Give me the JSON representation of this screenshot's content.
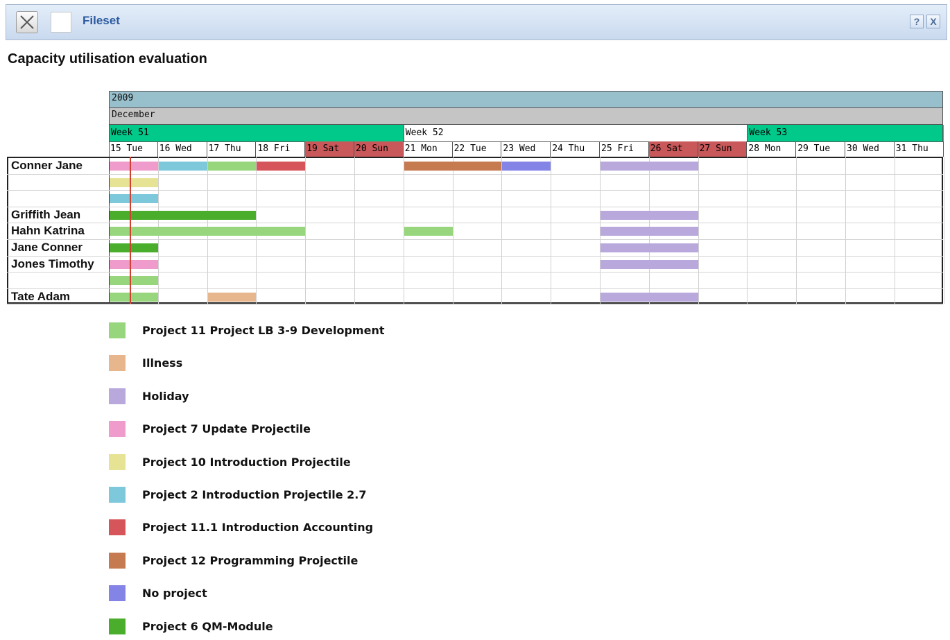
{
  "window": {
    "title": "Fileset",
    "help_label": "?",
    "close_label": "X"
  },
  "page_title": "Capacity utilisation evaluation",
  "timeline": {
    "year": "2009",
    "month": "December",
    "weeks": [
      {
        "label": "Week 51",
        "color": "#00c98a"
      },
      {
        "label": "Week 52",
        "color": "#ffffff"
      },
      {
        "label": "Week 53",
        "color": "#00c98a"
      }
    ],
    "days": [
      {
        "label": "15 Tue",
        "weekend": false
      },
      {
        "label": "16 Wed",
        "weekend": false
      },
      {
        "label": "17 Thu",
        "weekend": false
      },
      {
        "label": "18 Fri",
        "weekend": false
      },
      {
        "label": "19 Sat",
        "weekend": true
      },
      {
        "label": "20 Sun",
        "weekend": true
      },
      {
        "label": "21 Mon",
        "weekend": false
      },
      {
        "label": "22 Tue",
        "weekend": false
      },
      {
        "label": "23 Wed",
        "weekend": false
      },
      {
        "label": "24 Thu",
        "weekend": false
      },
      {
        "label": "25 Fri",
        "weekend": false
      },
      {
        "label": "26 Sat",
        "weekend": true
      },
      {
        "label": "27 Sun",
        "weekend": true
      },
      {
        "label": "28 Mon",
        "weekend": false
      },
      {
        "label": "29 Tue",
        "weekend": false
      },
      {
        "label": "30 Wed",
        "weekend": false
      },
      {
        "label": "31 Thu",
        "weekend": false
      }
    ],
    "today": "15 Tue"
  },
  "colors": {
    "year_bar": "#98c0cc",
    "month_bar": "#c5c5c5",
    "weekend": "#c8585a",
    "today_line": "#d04030"
  },
  "rows": [
    {
      "name": "Conner Jane",
      "bookings": [
        {
          "project": "p7",
          "from": "15 Tue",
          "to": "15 Tue"
        },
        {
          "project": "p2",
          "from": "16 Wed",
          "to": "16 Wed"
        },
        {
          "project": "p11",
          "from": "17 Thu",
          "to": "17 Thu"
        },
        {
          "project": "p111",
          "from": "18 Fri",
          "to": "18 Fri"
        },
        {
          "project": "p12",
          "from": "21 Mon",
          "to": "22 Tue"
        },
        {
          "project": "none",
          "from": "23 Wed",
          "to": "23 Wed"
        },
        {
          "project": "holiday",
          "from": "25 Fri",
          "to": "26 Sat"
        }
      ]
    },
    {
      "name": "",
      "bookings": [
        {
          "project": "p10",
          "from": "15 Tue",
          "to": "15 Tue"
        }
      ]
    },
    {
      "name": "",
      "bookings": [
        {
          "project": "p2",
          "from": "15 Tue",
          "to": "15 Tue"
        }
      ]
    },
    {
      "name": "Griffith Jean",
      "bookings": [
        {
          "project": "p6",
          "from": "15 Tue",
          "to": "17 Thu"
        },
        {
          "project": "holiday",
          "from": "25 Fri",
          "to": "26 Sat"
        }
      ]
    },
    {
      "name": "Hahn Katrina",
      "bookings": [
        {
          "project": "p11",
          "from": "15 Tue",
          "to": "18 Fri"
        },
        {
          "project": "p11",
          "from": "21 Mon",
          "to": "21 Mon"
        },
        {
          "project": "holiday",
          "from": "25 Fri",
          "to": "26 Sat"
        }
      ]
    },
    {
      "name": "Jane Conner",
      "bookings": [
        {
          "project": "p6",
          "from": "15 Tue",
          "to": "15 Tue"
        },
        {
          "project": "holiday",
          "from": "25 Fri",
          "to": "26 Sat"
        }
      ]
    },
    {
      "name": "Jones Timothy",
      "bookings": [
        {
          "project": "p7",
          "from": "15 Tue",
          "to": "15 Tue"
        },
        {
          "project": "holiday",
          "from": "25 Fri",
          "to": "26 Sat"
        }
      ]
    },
    {
      "name": "",
      "bookings": [
        {
          "project": "p11",
          "from": "15 Tue",
          "to": "15 Tue"
        }
      ]
    },
    {
      "name": "Tate Adam",
      "bookings": [
        {
          "project": "p11",
          "from": "15 Tue",
          "to": "15 Tue"
        },
        {
          "project": "illness",
          "from": "17 Thu",
          "to": "17 Thu"
        },
        {
          "project": "holiday",
          "from": "25 Fri",
          "to": "26 Sat"
        }
      ]
    }
  ],
  "legend": [
    {
      "key": "p11",
      "label": "Project 11 Project LB 3-9 Development",
      "color": "#97d67c"
    },
    {
      "key": "illness",
      "label": "Illness",
      "color": "#e8b68c"
    },
    {
      "key": "holiday",
      "label": "Holiday",
      "color": "#b8a8dc"
    },
    {
      "key": "p7",
      "label": "Project 7 Update Projectile",
      "color": "#ef9ccc"
    },
    {
      "key": "p10",
      "label": "Project 10 Introduction Projectile",
      "color": "#e6e394"
    },
    {
      "key": "p2",
      "label": "Project 2 Introduction Projectile 2.7",
      "color": "#7ec8dc"
    },
    {
      "key": "p111",
      "label": "Project 11.1 Introduction Accounting",
      "color": "#d5555a"
    },
    {
      "key": "p12",
      "label": "Project 12 Programming Projectile",
      "color": "#c67a50"
    },
    {
      "key": "none",
      "label": "No project",
      "color": "#8484e6"
    },
    {
      "key": "p6",
      "label": "Project 6 QM-Module",
      "color": "#4aae2c"
    }
  ]
}
